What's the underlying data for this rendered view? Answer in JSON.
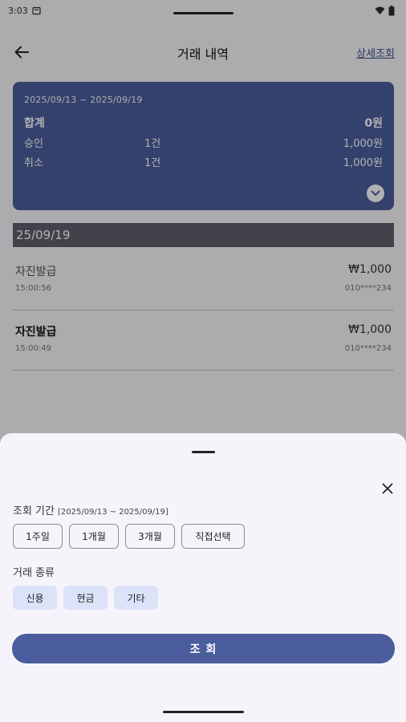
{
  "status_bar": {
    "time": "3:03"
  },
  "app_bar": {
    "title": "거래 내역",
    "detail_link": "상세조회"
  },
  "summary": {
    "period": "2025/09/13 ~ 2025/09/19",
    "total_label": "합계",
    "total_amount": "0원",
    "approve_label": "승인",
    "approve_count": "1건",
    "approve_amount": "1,000원",
    "cancel_label": "취소",
    "cancel_count": "1건",
    "cancel_amount": "1,000원"
  },
  "date_header": "25/09/19",
  "transactions": [
    {
      "title": "자진발급",
      "amount": "₩1,000",
      "time": "15:00:56",
      "phone": "010****234"
    },
    {
      "title": "자진발급",
      "amount": "₩1,000",
      "time": "15:00:49",
      "phone": "010****234"
    }
  ],
  "sheet": {
    "period_label": "조회 기간",
    "period_range": "[2025/09/13 ~ 2025/09/19]",
    "period_options": [
      "1주일",
      "1개월",
      "3개월",
      "직접선택"
    ],
    "type_label": "거래 종류",
    "type_options": [
      "신용",
      "현금",
      "기타"
    ],
    "search_button": "조 회"
  },
  "colors": {
    "primary": "#4b5d9c",
    "chip_fill": "#dce2f7",
    "date_header": "#5d5f6b"
  }
}
